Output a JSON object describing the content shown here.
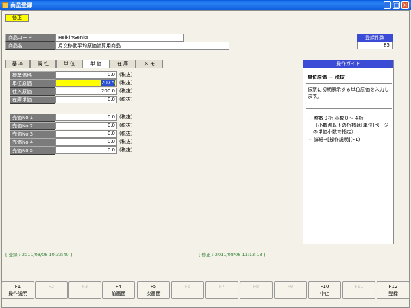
{
  "window": {
    "title": "商品登録",
    "min": "_",
    "max": "□",
    "close": "×"
  },
  "mode_badge": "修正",
  "header": {
    "code_label": "商品コード",
    "code_value": "HeikinGenka",
    "name_label": "商品名",
    "name_value": "月次移動平均原価計算用商品",
    "count_label": "登録件数",
    "count_value": "85"
  },
  "tabs": [
    "基 本",
    "属 性",
    "単 位",
    "単 価",
    "在 庫",
    "メ モ"
  ],
  "active_tab": "単 価",
  "prices": [
    {
      "label": "標準価格",
      "value": "0.0",
      "tax": "(税抜)"
    },
    {
      "label": "単位原価",
      "value": "207.5",
      "tax": "(税抜)"
    },
    {
      "label": "仕入原価",
      "value": "200.0",
      "tax": "(税抜)"
    },
    {
      "label": "在庫単価",
      "value": "0.0",
      "tax": "(税抜)"
    }
  ],
  "sale_prices": [
    {
      "label": "売価No.1",
      "value": "0.0",
      "tax": "(税抜)"
    },
    {
      "label": "売価No.2",
      "value": "0.0",
      "tax": "(税抜)"
    },
    {
      "label": "売価No.3",
      "value": "0.0",
      "tax": "(税抜)"
    },
    {
      "label": "売価No.4",
      "value": "0.0",
      "tax": "(税抜)"
    },
    {
      "label": "売価No.5",
      "value": "0.0",
      "tax": "(税抜)"
    }
  ],
  "guide": {
    "header": "操作ガイド",
    "title": "単位原価 － 税抜",
    "body1": "伝票に初期表示する単位原価を入力します。",
    "bullet1": "・ 整数９桁 小数０～４桁",
    "bullet1b": "（小数点以下の桁数は[単位]ページの単価小数で指定）",
    "bullet2": "・ 詳細⇒[操作説明](F1)"
  },
  "status": {
    "registered": "[ 登録 :  2011/08/08 10:32:40 ]",
    "modified": "[ 修正 :  2011/08/08 11:13:18 ]"
  },
  "fkeys": [
    {
      "num": "F1",
      "label": "操作説明",
      "enabled": true
    },
    {
      "num": "F2",
      "label": "",
      "enabled": false
    },
    {
      "num": "F3",
      "label": "",
      "enabled": false
    },
    {
      "num": "F4",
      "label": "前画面",
      "enabled": true
    },
    {
      "num": "F5",
      "label": "次画面",
      "enabled": true
    },
    {
      "num": "F6",
      "label": "",
      "enabled": false
    },
    {
      "num": "F7",
      "label": "",
      "enabled": false
    },
    {
      "num": "F8",
      "label": "",
      "enabled": false
    },
    {
      "num": "F9",
      "label": "",
      "enabled": false
    },
    {
      "num": "F10",
      "label": "中止",
      "enabled": true
    },
    {
      "num": "F11",
      "label": "",
      "enabled": false
    },
    {
      "num": "F12",
      "label": "登録",
      "enabled": true
    }
  ]
}
